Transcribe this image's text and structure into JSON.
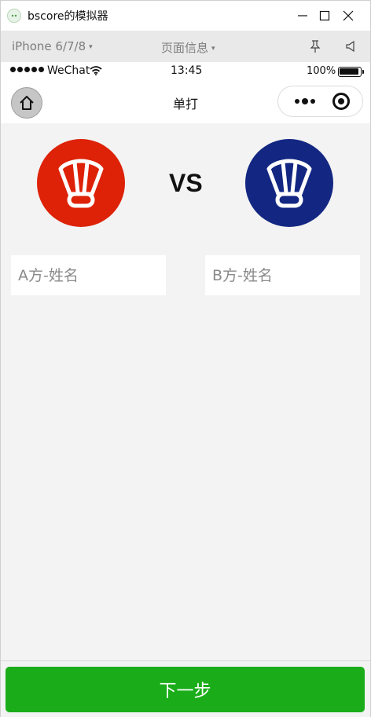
{
  "window": {
    "title": "bscore的模拟器",
    "buttons": {
      "minimize": "minimize-icon",
      "maximize": "maximize-icon",
      "close": "close-icon"
    }
  },
  "toolbar": {
    "device": "iPhone 6/7/8",
    "page_info": "页面信息",
    "caret": "▾",
    "icons": [
      "pin-icon",
      "volume-icon"
    ]
  },
  "statusbar": {
    "carrier": "WeChat",
    "time": "13:45",
    "battery": "100%"
  },
  "navbar": {
    "title": "单打",
    "home_icon": "home-icon",
    "capsule_icons": [
      "more-icon",
      "exit-icon"
    ]
  },
  "match": {
    "vs": "VS",
    "team_a": {
      "logo_icon": "shuttlecock-icon",
      "color": "#dd2208",
      "placeholder": "A方-姓名"
    },
    "team_b": {
      "logo_icon": "shuttlecock-icon",
      "color": "#132782",
      "placeholder": "B方-姓名"
    }
  },
  "footer": {
    "next_label": "下一步",
    "accent": "#1aad19"
  }
}
